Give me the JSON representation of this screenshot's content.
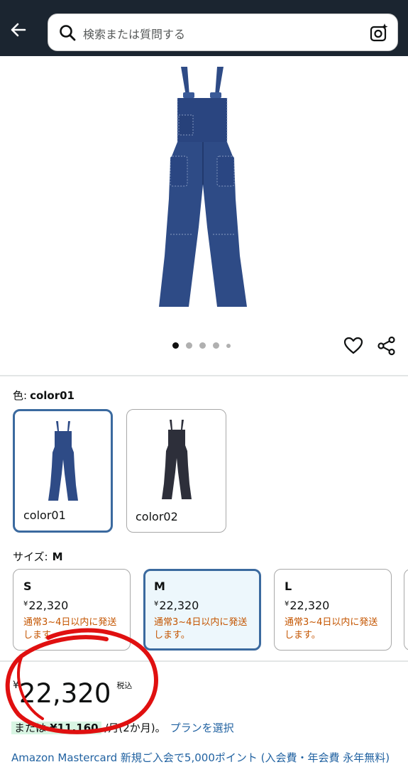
{
  "header": {
    "search_placeholder": "検索または質問する"
  },
  "product": {
    "image_pager": {
      "count": 5,
      "active": 0
    }
  },
  "color_section": {
    "label": "色:",
    "selected": "color01",
    "options": [
      {
        "name": "color01",
        "fill": "#2e4b86"
      },
      {
        "name": "color02",
        "fill": "#2d2f3a"
      }
    ]
  },
  "size_section": {
    "label": "サイズ:",
    "selected": "M",
    "options": [
      {
        "size": "S",
        "yen": "¥",
        "price": "22,320",
        "shipping": "通常3~4日以内に発送します。"
      },
      {
        "size": "M",
        "yen": "¥",
        "price": "22,320",
        "shipping": "通常3~4日以内に発送します。"
      },
      {
        "size": "L",
        "yen": "¥",
        "price": "22,320",
        "shipping": "通常3~4日以内に発送します。"
      }
    ]
  },
  "price": {
    "yen": "¥",
    "amount": "22,320",
    "tax": "税込",
    "monthly_prefix": "または",
    "monthly_amount": "¥11,160",
    "monthly_suffix": "/月(2か月)。",
    "plan_link": "プランを選択"
  },
  "promo": {
    "text": "Amazon Mastercard 新規ご入会で5,000ポイント (入会費・年会費 永年無料)"
  },
  "colors": {
    "header_bg": "#1b2530",
    "selected_border": "#3b6a9f",
    "shipping_text": "#c45500",
    "link": "#2162a1",
    "annotation_circle": "#e01010"
  }
}
